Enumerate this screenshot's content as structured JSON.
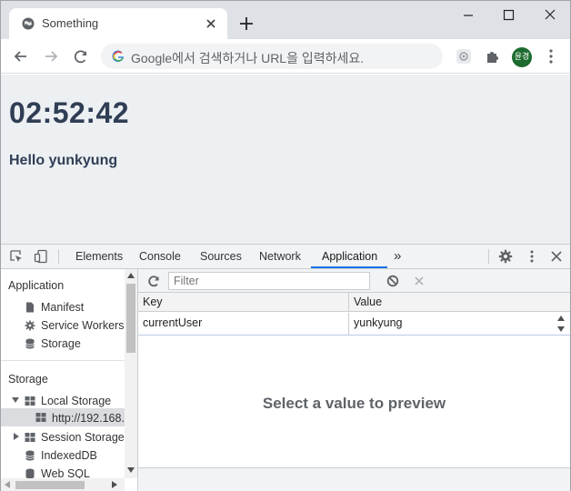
{
  "browser": {
    "tab_title": "Something",
    "omnibox_placeholder": "Google에서 검색하거나 URL을 입력하세요.",
    "profile_initials": "윤경"
  },
  "page": {
    "clock": "02:52:42",
    "greeting": "Hello yunkyung"
  },
  "devtools": {
    "tabs": [
      "Elements",
      "Console",
      "Sources",
      "Network",
      "Application"
    ],
    "active_tab": "Application",
    "more_tabs": "»",
    "accent_color": "#1a73e8",
    "sidebar": {
      "application_header": "Application",
      "application_items": [
        "Manifest",
        "Service Workers",
        "Storage"
      ],
      "storage_header": "Storage",
      "storage_items": {
        "local_storage": "Local Storage",
        "local_origin": "http://192.168.",
        "session_storage": "Session Storage",
        "indexeddb": "IndexedDB",
        "websql": "Web SQL"
      }
    },
    "filter_placeholder": "Filter",
    "table": {
      "columns": [
        "Key",
        "Value"
      ],
      "rows": [
        {
          "key": "currentUser",
          "value": "yunkyung"
        }
      ]
    },
    "preview_text": "Select a value to preview"
  }
}
